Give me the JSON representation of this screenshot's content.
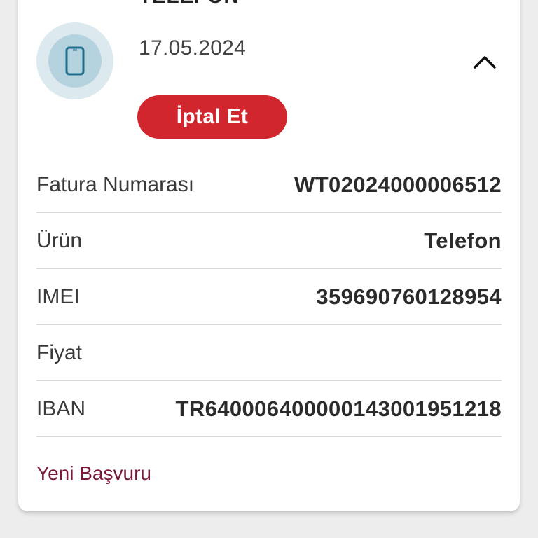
{
  "card": {
    "title": "TELEFON",
    "date": "17.05.2024",
    "icon": "mobile-phone-icon",
    "cancel_label": "İptal Et",
    "rows": [
      {
        "label": "Fatura Numarası",
        "value": "WT02024000006512"
      },
      {
        "label": "Ürün",
        "value": "Telefon"
      },
      {
        "label": "IMEI",
        "value": "359690760128954"
      },
      {
        "label": "Fiyat",
        "value": ""
      },
      {
        "label": "IBAN",
        "value": "TR640006400000143001951218"
      }
    ],
    "new_application_label": "Yeni Başvuru"
  },
  "colors": {
    "cancel_button": "#d2262e",
    "avatar_outer": "#dce9ef",
    "avatar_inner": "#b5d3df",
    "link": "#7a1a3c",
    "background": "#ededed"
  }
}
